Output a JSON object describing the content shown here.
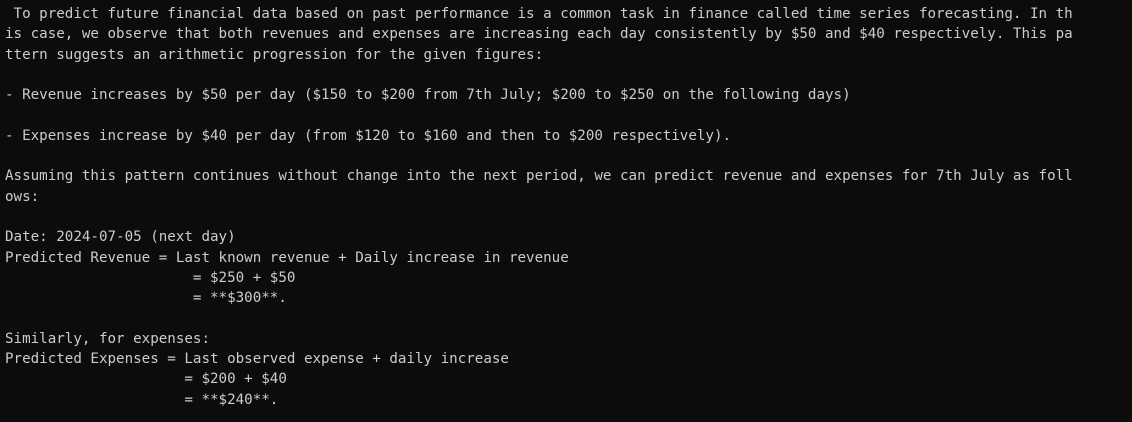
{
  "terminal": {
    "lines": [
      " To predict future financial data based on past performance is a common task in finance called time series forecasting. In th",
      "is case, we observe that both revenues and expenses are increasing each day consistently by $50 and $40 respectively. This pa",
      "ttern suggests an arithmetic progression for the given figures:",
      "",
      "- Revenue increases by $50 per day ($150 to $200 from 7th July; $200 to $250 on the following days)",
      "",
      "- Expenses increase by $40 per day (from $120 to $160 and then to $200 respectively).",
      "",
      "Assuming this pattern continues without change into the next period, we can predict revenue and expenses for 7th July as foll",
      "ows:",
      "",
      "Date: 2024-07-05 (next day)",
      "Predicted Revenue = Last known revenue + Daily increase in revenue",
      "                      = $250 + $50",
      "                      = **$300**.",
      "",
      "Similarly, for expenses:",
      "Predicted Expenses = Last observed expense + daily increase",
      "                     = $200 + $40",
      "                     = **$240**."
    ]
  }
}
